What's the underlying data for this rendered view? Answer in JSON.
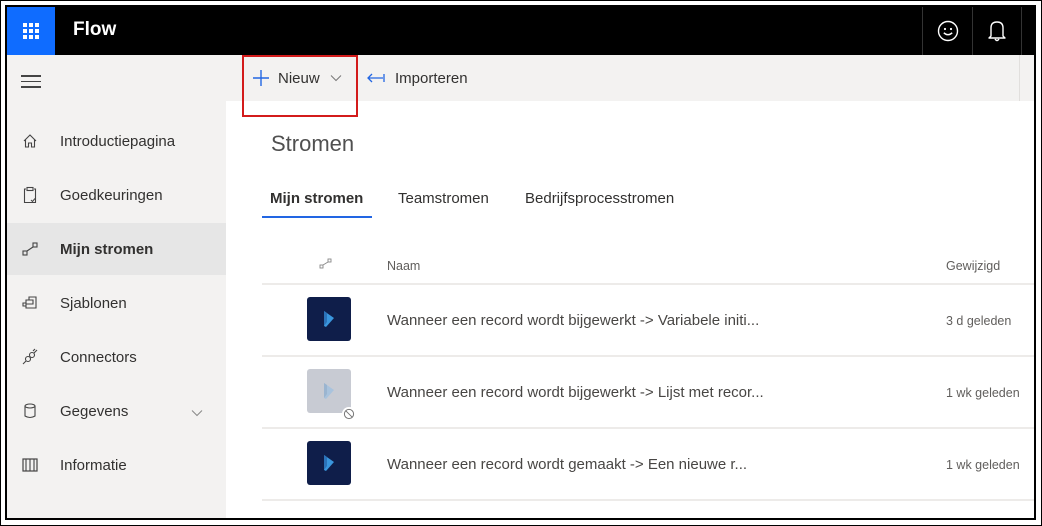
{
  "topbar": {
    "app_title": "Flow",
    "waffle_icon": "app-launcher-icon",
    "buttons": [
      {
        "name": "feedback",
        "icon": "smiley-icon"
      },
      {
        "name": "notifications",
        "icon": "bell-icon"
      }
    ],
    "colors": {
      "background": "#000000",
      "launcher": "#0f6cff"
    }
  },
  "sidebar": {
    "menu_icon": "hamburger-icon",
    "items": [
      {
        "label": "Introductiepagina",
        "icon": "home-icon",
        "active": false
      },
      {
        "label": "Goedkeuringen",
        "icon": "clipboard-check-icon",
        "active": false
      },
      {
        "label": "Mijn stromen",
        "icon": "flow-icon",
        "active": true
      },
      {
        "label": "Sjablonen",
        "icon": "templates-icon",
        "active": false
      },
      {
        "label": "Connectors",
        "icon": "plug-icon",
        "active": false
      },
      {
        "label": "Gegevens",
        "icon": "database-icon",
        "active": false,
        "expandable": true
      },
      {
        "label": "Informatie",
        "icon": "book-icon",
        "active": false
      }
    ]
  },
  "commandbar": {
    "new_label": "Nieuw",
    "import_label": "Importeren"
  },
  "main": {
    "title": "Stromen",
    "tabs": [
      {
        "label": "Mijn stromen",
        "active": true
      },
      {
        "label": "Teamstromen",
        "active": false
      },
      {
        "label": "Bedrijfsprocesstromen",
        "active": false
      }
    ],
    "table": {
      "columns": {
        "icon": "flow-icon",
        "name": "Naam",
        "modified": "Gewijzigd"
      },
      "rows": [
        {
          "name": "Wanneer een record wordt bijgewerkt -> Variabele initi...",
          "modified": "3 d geleden",
          "disabled": false
        },
        {
          "name": "Wanneer een record wordt bijgewerkt -> Lijst met recor...",
          "modified": "1 wk geleden",
          "disabled": true
        },
        {
          "name": "Wanneer een record wordt gemaakt -> Een nieuwe r...",
          "modified": "1 wk geleden",
          "disabled": false
        }
      ]
    },
    "accent_color": "#2266e3"
  }
}
